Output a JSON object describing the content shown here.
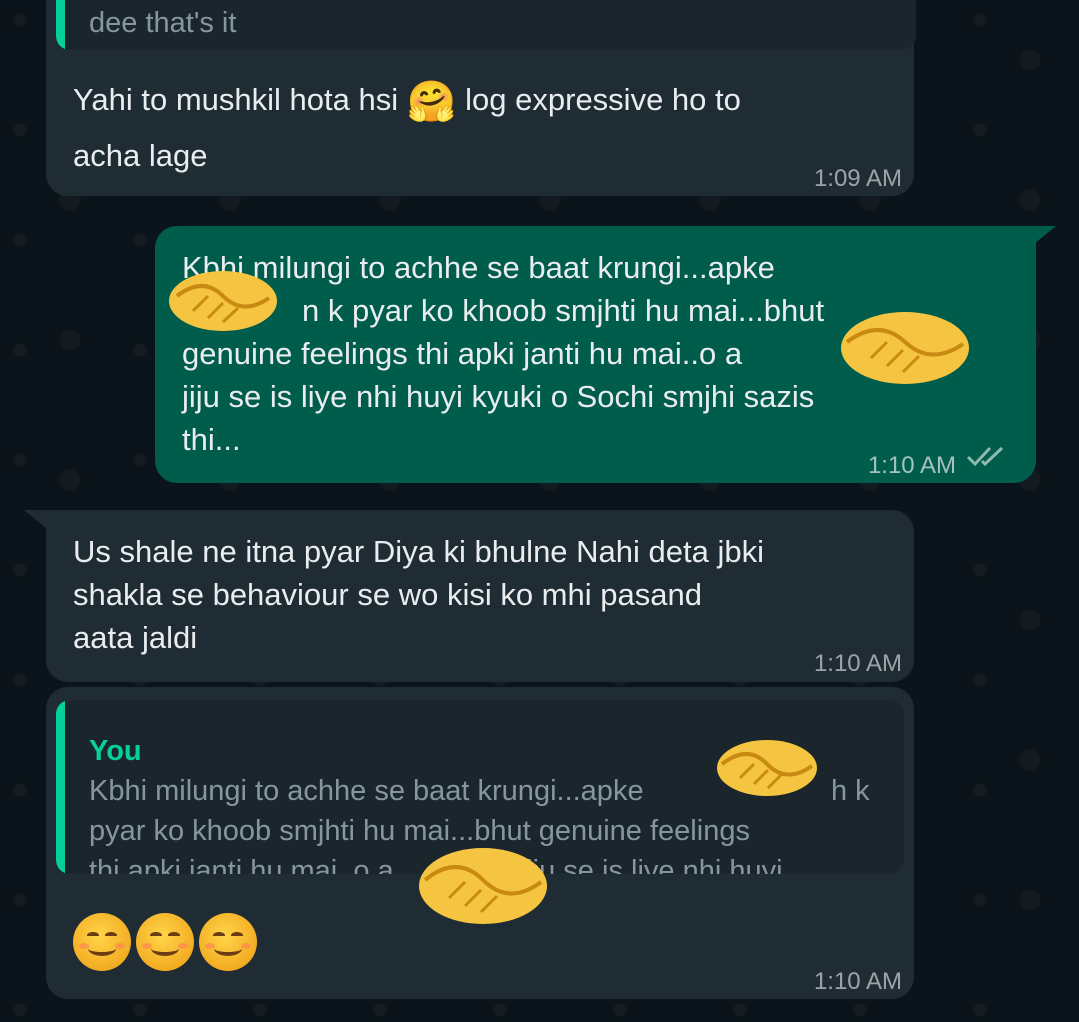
{
  "messages": [
    {
      "quote_tail": "dee that's it",
      "text_line1": "Yahi to mushkil hota hsi",
      "emoji": "🤗",
      "text_line1b": "log expressive ho to",
      "text_line2": "acha lage",
      "time": "1:09 AM"
    },
    {
      "lines": [
        "Kbhi milungi to achhe se baat krungi...apke",
        "n k pyar ko khoob smjhti hu mai...bhut",
        "genuine feelings thi apki janti hu mai..o a",
        "jiju se is liye nhi huyi kyuki o Sochi smjhi sazis",
        "thi..."
      ],
      "time": "1:10 AM",
      "status_icon": "double-check-icon"
    },
    {
      "lines": [
        "Us shale ne itna pyar Diya ki bhulne Nahi deta jbki",
        "shakla se behaviour se wo kisi ko mhi pasand",
        "aata jaldi"
      ],
      "time": "1:10 AM"
    },
    {
      "quote_author": "You",
      "quote_lines": [
        "Kbhi milungi to achhe se baat krungi...apke",
        "pyar ko khoob smjhti hu mai...bhut genuine feelings",
        "thi apki janti hu mai..o a",
        "jiju se is liye nhi huyi ..."
      ],
      "quote_fragment": "h k",
      "emojis": [
        "😊",
        "😊",
        "😊"
      ],
      "time": "1:10 AM"
    }
  ],
  "stickers": [
    "handshake-sticker",
    "handshake-sticker",
    "handshake-sticker",
    "handshake-sticker"
  ],
  "colors": {
    "background": "#0b141a",
    "incoming_bubble": "#202c33",
    "outgoing_bubble": "#005c4b",
    "quote_accent": "#06cf9c"
  }
}
